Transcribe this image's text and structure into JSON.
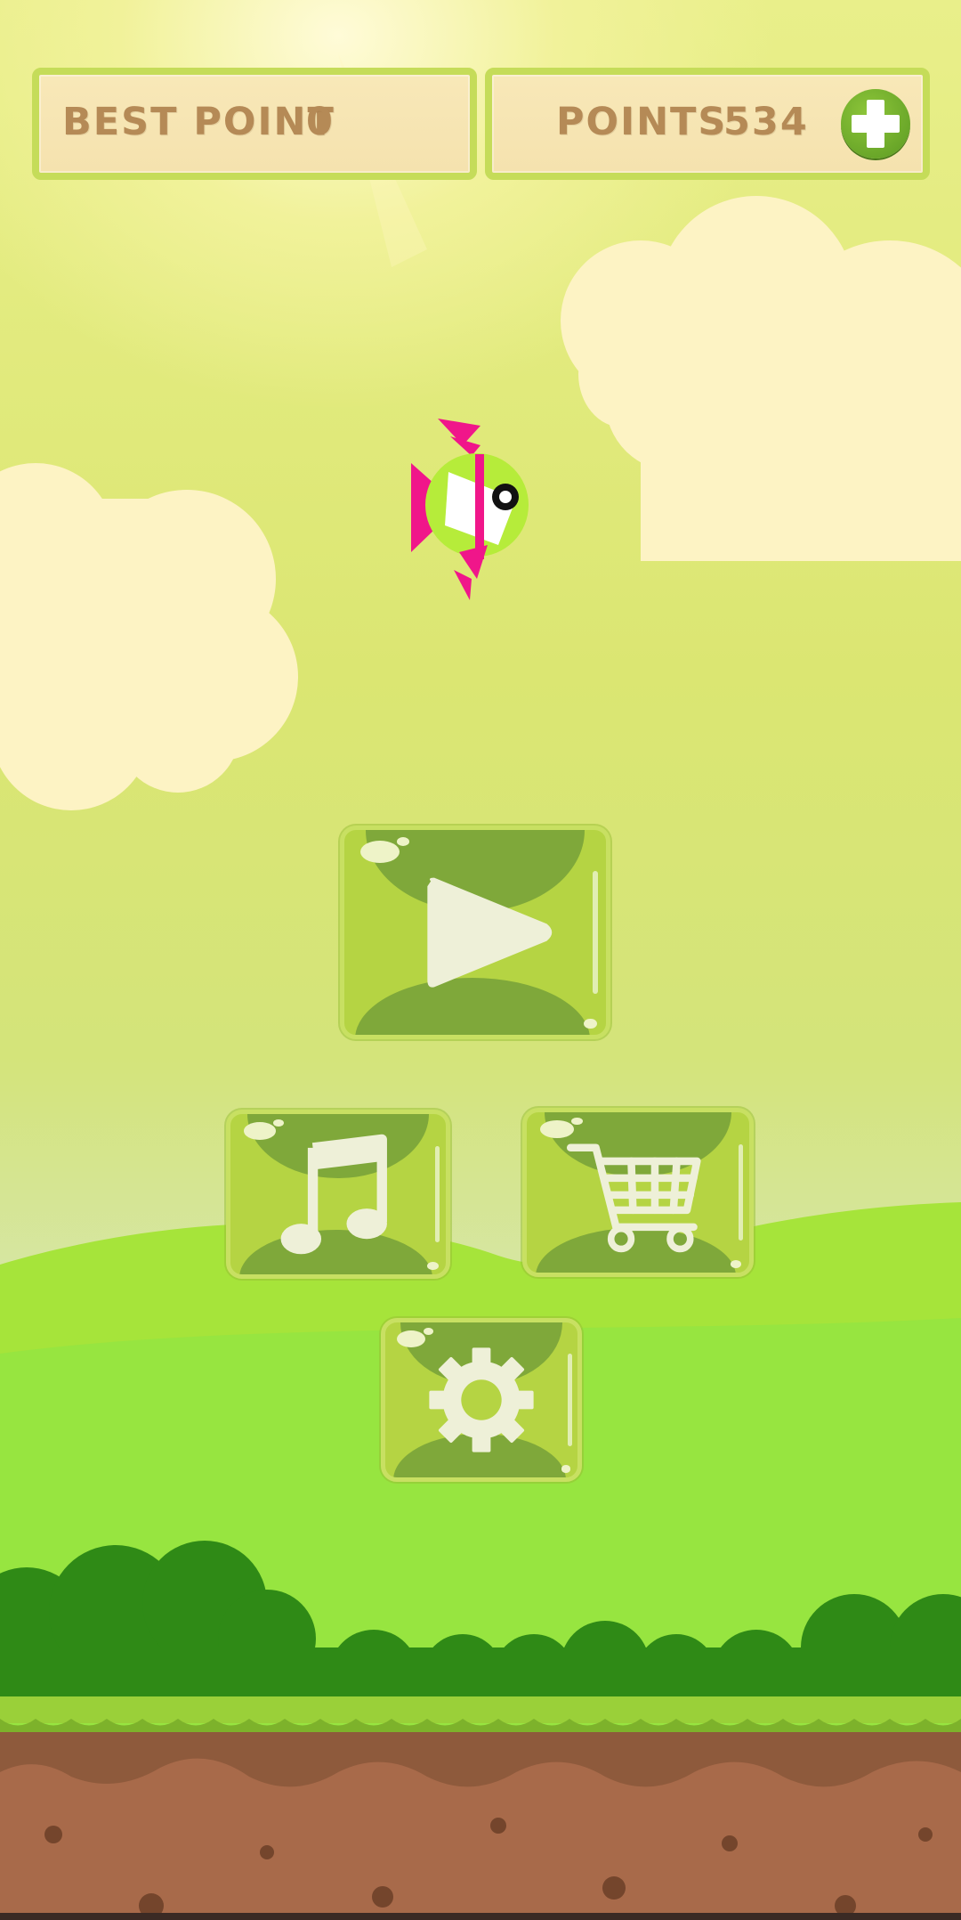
{
  "hud": {
    "best_label": "BEST POINT",
    "best_value": "0",
    "points_label": "POINTS",
    "points_value": "534",
    "add_icon": "plus-icon"
  },
  "menu": {
    "play_icon": "play-icon",
    "music_icon": "music-note-icon",
    "shop_icon": "shopping-cart-icon",
    "settings_icon": "gear-icon"
  },
  "colors": {
    "panel_text": "#b58a56",
    "panel_border": "#c5dc59",
    "jelly": "#b5d443",
    "fish_accent": "#f0168a",
    "fish_body": "#b6ec3a"
  }
}
